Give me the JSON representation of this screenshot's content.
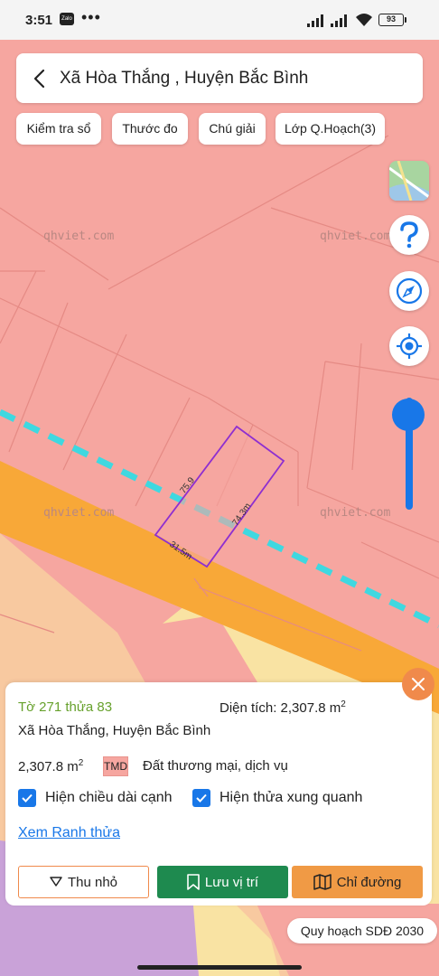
{
  "status_bar": {
    "time": "3:51",
    "battery": "93"
  },
  "header": {
    "title": "Xã Hòa Thắng , Huyện Bắc Bình"
  },
  "chips": [
    {
      "label": "Kiểm tra sổ"
    },
    {
      "label": "Thước đo"
    },
    {
      "label": "Chú giải"
    },
    {
      "label": "Lớp Q.Hoạch(3)"
    }
  ],
  "map": {
    "watermarks": [
      "qhviet.com",
      "qhviet.com",
      "qhviet.com",
      "qhviet.com"
    ],
    "edge_labels": [
      "75.9",
      "74.3m",
      "31.5m"
    ],
    "colors": {
      "land_commercial": "#f6a6a0",
      "road": "#f8a838",
      "residential": "#f9e3a3",
      "planning_line": "#3fd8e0",
      "parcel_outline": "#8e2fd0",
      "accent": "#1877e8"
    }
  },
  "map_controls": {
    "layers_icon": "map-thumbnail-icon",
    "help_icon": "question-icon",
    "compass_icon": "compass-icon",
    "location_icon": "my-location-icon",
    "zoom_level": 0.15
  },
  "panel": {
    "parcel": "Tờ 271 thửa 83",
    "area_label": "Diện tích: 2,307.8 m",
    "area_unit_sup": "2",
    "address": "Xã Hòa Thắng, Huyện Bắc Bình",
    "size_value": "2,307.8 m",
    "size_unit_sup": "2",
    "land_code": "TMD",
    "land_use": "Đất thương mại, dịch vụ",
    "show_edge_lengths": "Hiện chiều dài cạnh",
    "show_neighbors": "Hiện thửa xung quanh",
    "view_boundary": "Xem Ranh thửa",
    "collapse": "Thu nhỏ",
    "save_location": "Lưu vị trí",
    "directions": "Chỉ đường"
  },
  "plan_badge": "Quy hoạch SDĐ 2030"
}
